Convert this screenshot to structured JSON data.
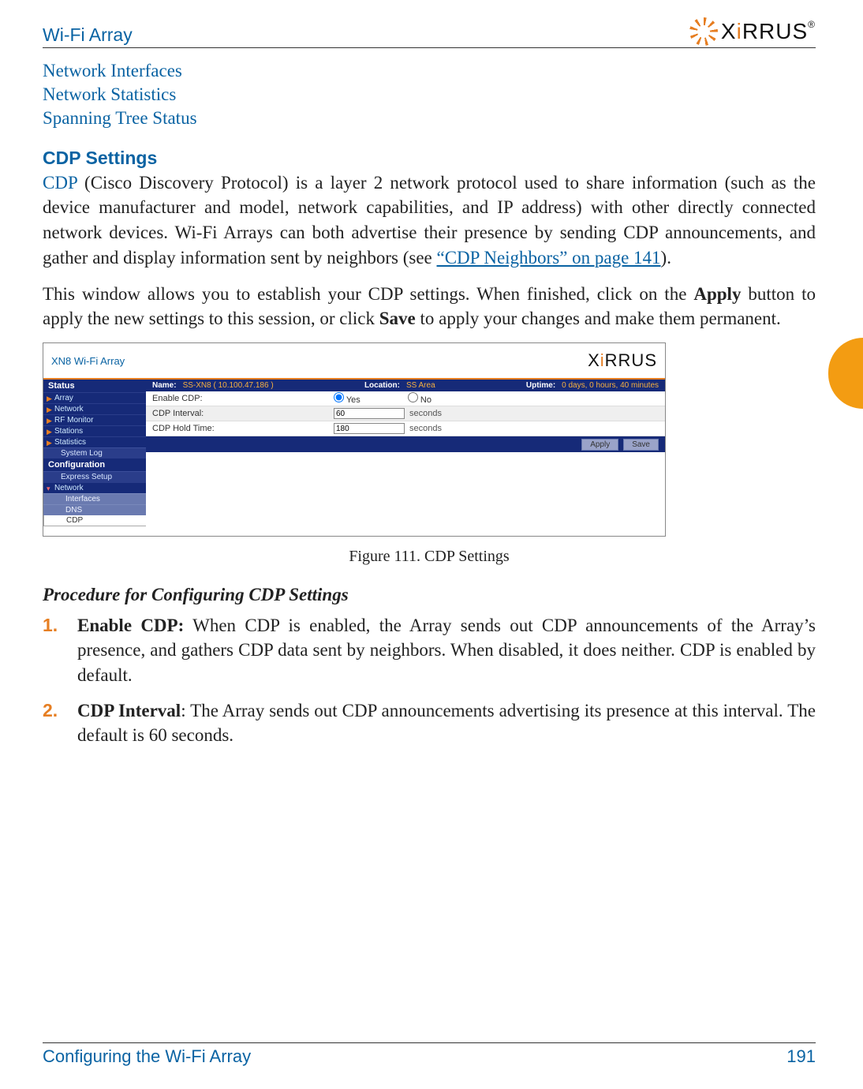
{
  "header": {
    "left": "Wi-Fi Array",
    "logo_text_parts": {
      "x": "X",
      "i": "i",
      "rrus": "RRUS",
      "reg": "®"
    }
  },
  "links": {
    "l1": "Network Interfaces",
    "l2": "Network Statistics",
    "l3": "Spanning Tree Status"
  },
  "section": {
    "heading": "CDP Settings",
    "cdp_term": "CDP",
    "p1_rest": " (Cisco Discovery Protocol) is a layer 2 network protocol used to share information (such as the device manufacturer and model, network capabilities, and IP address) with other directly connected network devices. Wi-Fi Arrays can both advertise their presence by sending CDP announcements, and gather and display information sent by neighbors (see ",
    "p1_xref": "“CDP Neighbors” on page 141",
    "p1_tail": ").",
    "p2_a": "This window allows you to establish your CDP settings. When finished, click on the ",
    "p2_b": "Apply",
    "p2_c": " button to apply the new settings to this session, or click ",
    "p2_d": "Save",
    "p2_e": " to apply your changes and make them permanent."
  },
  "figure": {
    "caption": "Figure 111. CDP Settings"
  },
  "screenshot": {
    "title": "XN8 Wi-Fi Array",
    "logo": {
      "x": "X",
      "i": "i",
      "rrus": "RRUS"
    },
    "statusbar": {
      "name_lbl": "Name:",
      "name_val": "SS-XN8   ( 10.100.47.186 )",
      "loc_lbl": "Location:",
      "loc_val": "SS Area",
      "up_lbl": "Uptime:",
      "up_val": "0 days, 0 hours, 40 minutes"
    },
    "nav": {
      "status": "Status",
      "array": "Array",
      "network": "Network",
      "rf": "RF Monitor",
      "stations": "Stations",
      "stats": "Statistics",
      "syslog": "System Log",
      "config": "Configuration",
      "express": "Express Setup",
      "net2": "Network",
      "ifaces": "Interfaces",
      "dns": "DNS",
      "cdp": "CDP"
    },
    "form": {
      "enable_lbl": "Enable CDP:",
      "yes": "Yes",
      "no": "No",
      "interval_lbl": "CDP Interval:",
      "interval_val": "60",
      "hold_lbl": "CDP Hold Time:",
      "hold_val": "180",
      "unit": "seconds",
      "apply": "Apply",
      "save": "Save"
    }
  },
  "procedure": {
    "heading": "Procedure for Configuring CDP Settings",
    "steps": [
      {
        "num": "1.",
        "bold": "Enable CDP:",
        "rest": " When CDP is enabled, the Array sends out CDP announcements of the Array’s presence, and gathers CDP data sent by neighbors. When disabled, it does neither. CDP is enabled by default."
      },
      {
        "num": "2.",
        "bold": "CDP Interval",
        "rest": ": The Array sends out CDP announcements advertising its presence at this interval. The default is 60 seconds."
      }
    ]
  },
  "footer": {
    "left": "Configuring the Wi-Fi Array",
    "right": "191"
  }
}
